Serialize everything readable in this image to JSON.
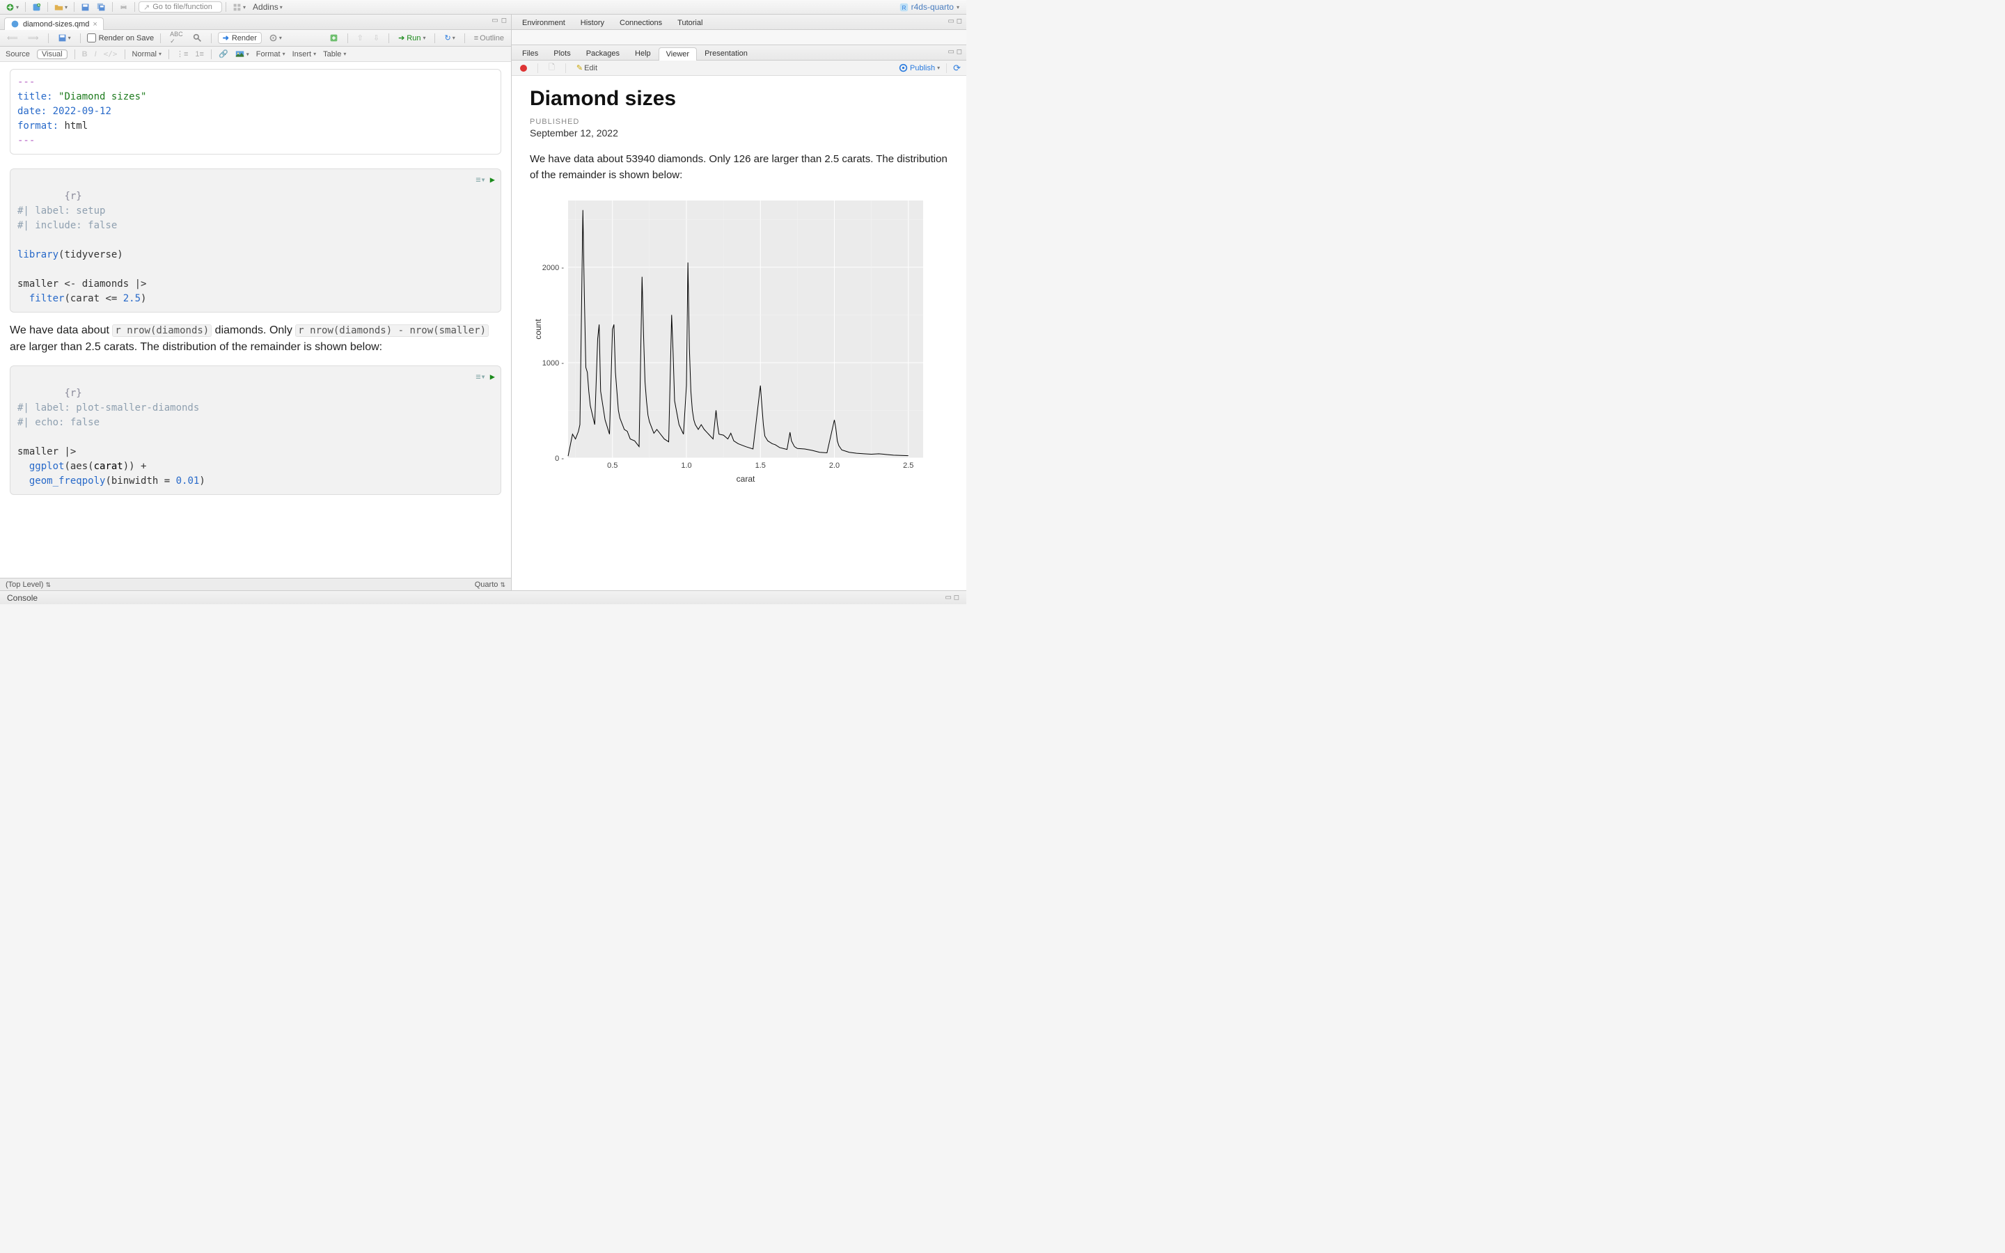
{
  "project": "r4ds-quarto",
  "top": {
    "goto_placeholder": "Go to file/function",
    "addins": "Addins"
  },
  "file_tab": "diamond-sizes.qmd",
  "sec": {
    "render_on_save": "Render on Save",
    "render": "Render",
    "run": "Run",
    "outline": "Outline"
  },
  "tert": {
    "source": "Source",
    "visual": "Visual",
    "normal": "Normal",
    "format": "Format",
    "insert": "Insert",
    "table": "Table"
  },
  "editor": {
    "yaml_title_key": "title:",
    "yaml_title_val": "\"Diamond sizes\"",
    "yaml_date_key": "date:",
    "yaml_date_val": "2022-09-12",
    "yaml_format_key": "format:",
    "yaml_format_val": "html",
    "chunk1_head": "{r}",
    "chunk1_l1": "#| label: setup",
    "chunk1_l2": "#| include: false",
    "chunk1_l3a": "library",
    "chunk1_l3b": "(tidyverse)",
    "chunk1_l4": "smaller <- diamonds |>",
    "chunk1_l5a": "  filter",
    "chunk1_l5b": "(carat <= ",
    "chunk1_l5c": "2.5",
    "chunk1_l5d": ")",
    "prose1a": "We have data about ",
    "inline1": "r nrow(diamonds)",
    "prose1b": " diamonds. Only ",
    "inline2": "r nrow(diamonds) - nrow(smaller)",
    "prose1c": " are larger than 2.5 carats. The distribution of the remainder is shown below:",
    "chunk2_head": "{r}",
    "chunk2_l1": "#| label: plot-smaller-diamonds",
    "chunk2_l2": "#| echo: false",
    "chunk2_l3": "smaller |>",
    "chunk2_l4a": "  ggplot",
    "chunk2_l4b": "(aes(",
    "chunk2_l4c": "carat",
    "chunk2_l4d": ")) +",
    "chunk2_l5a": "  geom_freqpoly",
    "chunk2_l5b": "(binwidth = ",
    "chunk2_l5c": "0.01",
    "chunk2_l5d": ")"
  },
  "status": {
    "top_level": "(Top Level)",
    "quarto": "Quarto"
  },
  "console": "Console",
  "env_tabs": [
    "Environment",
    "History",
    "Connections",
    "Tutorial"
  ],
  "file_tabs": [
    "Files",
    "Plots",
    "Packages",
    "Help",
    "Viewer",
    "Presentation"
  ],
  "viewer_bar": {
    "edit": "Edit",
    "publish": "Publish"
  },
  "viewer": {
    "title": "Diamond sizes",
    "published_label": "PUBLISHED",
    "published_date": "September 12, 2022",
    "body": "We have data about 53940 diamonds. Only 126 are larger than 2.5 carats. The distribution of the remainder is shown below:"
  },
  "chart_data": {
    "type": "line",
    "title": "",
    "xlabel": "carat",
    "ylabel": "count",
    "xlim": [
      0.2,
      2.6
    ],
    "ylim": [
      0,
      2700
    ],
    "xticks": [
      0.5,
      1.0,
      1.5,
      2.0,
      2.5
    ],
    "yticks": [
      0,
      1000,
      2000
    ],
    "series": [
      {
        "name": "count",
        "x": [
          0.2,
          0.23,
          0.25,
          0.27,
          0.28,
          0.3,
          0.31,
          0.32,
          0.33,
          0.34,
          0.35,
          0.38,
          0.4,
          0.41,
          0.42,
          0.45,
          0.48,
          0.5,
          0.51,
          0.52,
          0.53,
          0.54,
          0.55,
          0.58,
          0.6,
          0.62,
          0.65,
          0.68,
          0.7,
          0.71,
          0.72,
          0.73,
          0.74,
          0.75,
          0.78,
          0.8,
          0.82,
          0.85,
          0.88,
          0.9,
          0.91,
          0.92,
          0.95,
          0.98,
          1.0,
          1.01,
          1.02,
          1.03,
          1.04,
          1.05,
          1.06,
          1.08,
          1.1,
          1.12,
          1.15,
          1.18,
          1.2,
          1.21,
          1.22,
          1.25,
          1.28,
          1.3,
          1.32,
          1.35,
          1.4,
          1.45,
          1.5,
          1.51,
          1.52,
          1.53,
          1.55,
          1.58,
          1.6,
          1.63,
          1.68,
          1.7,
          1.71,
          1.73,
          1.75,
          1.8,
          1.85,
          1.9,
          1.95,
          2.0,
          2.01,
          2.02,
          2.03,
          2.05,
          2.08,
          2.1,
          2.15,
          2.2,
          2.25,
          2.3,
          2.4,
          2.5
        ],
        "y": [
          20,
          250,
          200,
          280,
          350,
          2600,
          1700,
          950,
          900,
          700,
          550,
          350,
          1250,
          1400,
          700,
          400,
          250,
          1350,
          1400,
          900,
          700,
          500,
          420,
          300,
          280,
          200,
          180,
          120,
          1900,
          1300,
          800,
          600,
          450,
          380,
          260,
          300,
          260,
          200,
          170,
          1500,
          1100,
          600,
          350,
          250,
          760,
          2050,
          1150,
          700,
          500,
          400,
          350,
          300,
          350,
          300,
          250,
          200,
          500,
          350,
          250,
          240,
          200,
          260,
          180,
          150,
          120,
          95,
          760,
          550,
          350,
          230,
          180,
          150,
          140,
          110,
          90,
          270,
          180,
          120,
          100,
          95,
          80,
          60,
          55,
          400,
          310,
          180,
          130,
          85,
          70,
          60,
          50,
          45,
          40,
          45,
          30,
          25
        ]
      }
    ]
  }
}
